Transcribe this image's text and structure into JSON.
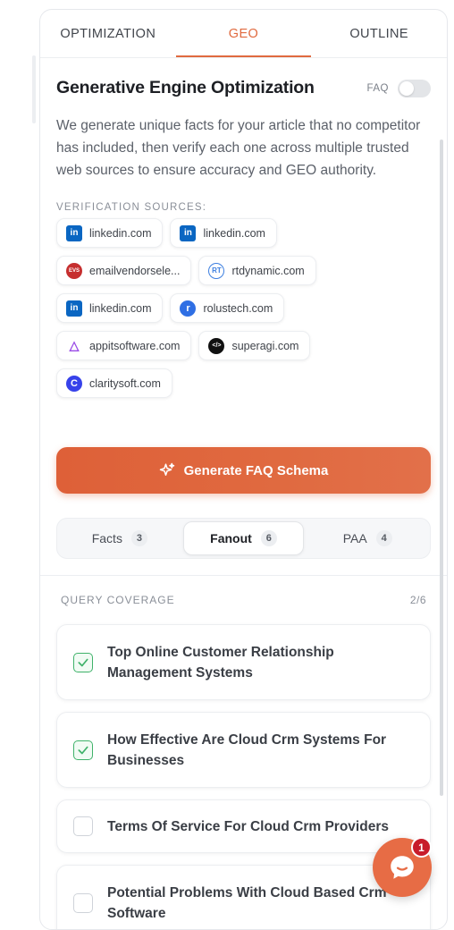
{
  "tabs": [
    "OPTIMIZATION",
    "GEO",
    "OUTLINE"
  ],
  "active_tab": "GEO",
  "title": "Generative Engine Optimization",
  "faq_label": "FAQ",
  "faq_enabled": false,
  "description": "We generate unique facts for your article that no competitor has included, then verify each one across multiple trusted web sources to ensure accuracy and GEO authority.",
  "sources_title": "VERIFICATION SOURCES:",
  "sources": [
    {
      "icon": "linkedin-icon",
      "label": "linkedin.com"
    },
    {
      "icon": "linkedin-icon",
      "label": "linkedin.com"
    },
    {
      "icon": "emailvendorselection-icon",
      "label": "emailvendorsele..."
    },
    {
      "icon": "rtdynamic-icon",
      "label": "rtdynamic.com"
    },
    {
      "icon": "linkedin-icon",
      "label": "linkedin.com"
    },
    {
      "icon": "rolustech-icon",
      "label": "rolustech.com"
    },
    {
      "icon": "appitsoftware-icon",
      "label": "appitsoftware.com"
    },
    {
      "icon": "superagi-icon",
      "label": "superagi.com"
    },
    {
      "icon": "claritysoft-icon",
      "label": "claritysoft.com"
    }
  ],
  "generate_button": "Generate FAQ Schema",
  "segments": [
    {
      "label": "Facts",
      "count": "3"
    },
    {
      "label": "Fanout",
      "count": "6"
    },
    {
      "label": "PAA",
      "count": "4"
    }
  ],
  "active_segment": "Fanout",
  "coverage_title": "QUERY COVERAGE",
  "coverage_count": "2/6",
  "queries": [
    {
      "text": "Top Online Customer Relationship Management Systems",
      "checked": true
    },
    {
      "text": "How Effective Are Cloud Crm Systems For Businesses",
      "checked": true
    },
    {
      "text": "Terms Of Service For Cloud Crm Providers",
      "checked": false
    },
    {
      "text": "Potential Problems With Cloud Based Crm Software",
      "checked": false
    }
  ],
  "chat_badge": "1",
  "colors": {
    "accent": "#e06a3f",
    "check": "#3fb26a",
    "badge": "#c81c2a"
  }
}
